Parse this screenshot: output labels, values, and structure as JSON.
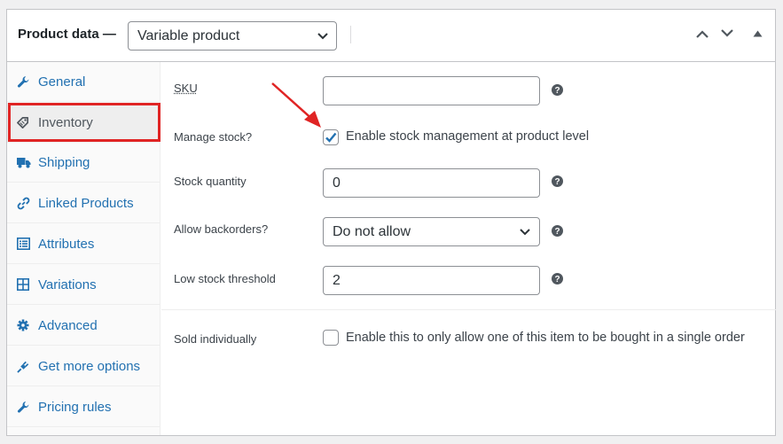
{
  "header": {
    "title": "Product data —",
    "product_type": "Variable product"
  },
  "tabs": [
    {
      "label": "General",
      "icon": "wrench-icon"
    },
    {
      "label": "Inventory",
      "icon": "tag-icon"
    },
    {
      "label": "Shipping",
      "icon": "truck-icon"
    },
    {
      "label": "Linked Products",
      "icon": "link-icon"
    },
    {
      "label": "Attributes",
      "icon": "list-icon"
    },
    {
      "label": "Variations",
      "icon": "grid-icon"
    },
    {
      "label": "Advanced",
      "icon": "gear-icon"
    },
    {
      "label": "Get more options",
      "icon": "plugin-icon"
    },
    {
      "label": "Pricing rules",
      "icon": "wrench-icon"
    }
  ],
  "active_tab": "Inventory",
  "inventory": {
    "sku": {
      "label": "SKU",
      "value": ""
    },
    "manage_stock": {
      "label": "Manage stock?",
      "checkbox_label": "Enable stock management at product level",
      "checked": true
    },
    "stock_quantity": {
      "label": "Stock quantity",
      "value": "0"
    },
    "backorders": {
      "label": "Allow backorders?",
      "selected": "Do not allow"
    },
    "low_stock": {
      "label": "Low stock threshold",
      "value": "2"
    },
    "sold_individually": {
      "label": "Sold individually",
      "checkbox_label": "Enable this to only allow one of this item to be bought in a single order",
      "checked": false
    }
  },
  "colors": {
    "link": "#2271b1",
    "highlight": "#e02424",
    "check": "#2271b1"
  }
}
